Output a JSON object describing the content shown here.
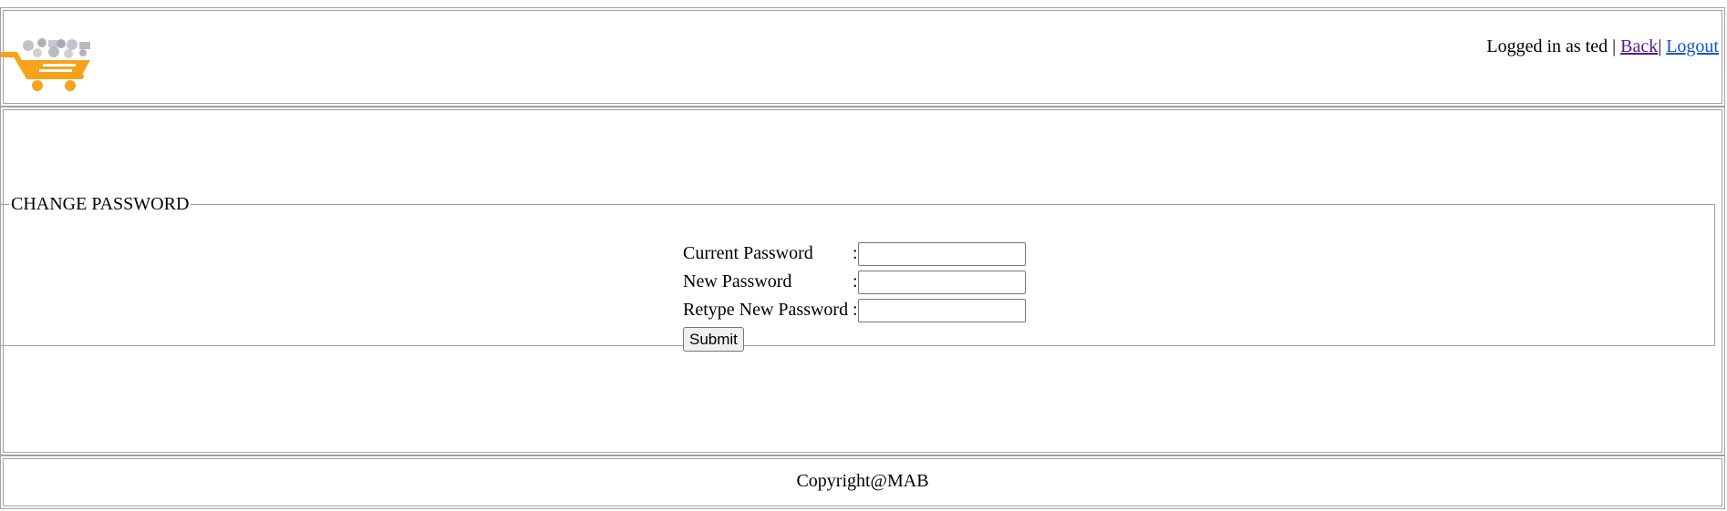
{
  "header": {
    "logo_icon": "shopping-cart-logo",
    "logged_in_text": "Logged in as ted |",
    "back_label": "Back",
    "separator": "|",
    "logout_label": "Logout"
  },
  "change_password": {
    "legend": "CHANGE PASSWORD",
    "fields": [
      {
        "label": "Current Password",
        "colon": ":",
        "value": ""
      },
      {
        "label": "New Password",
        "colon": ":",
        "value": ""
      },
      {
        "label": "Retype New Password",
        "colon": ":",
        "value": ""
      }
    ],
    "submit_label": "Submit"
  },
  "footer": {
    "copyright": "Copyright@MAB"
  },
  "colors": {
    "logo_orange": "#f7a21b",
    "logo_gray": "#b0b0b8",
    "link": "#0b57d0",
    "visited_link": "#551a8b"
  }
}
